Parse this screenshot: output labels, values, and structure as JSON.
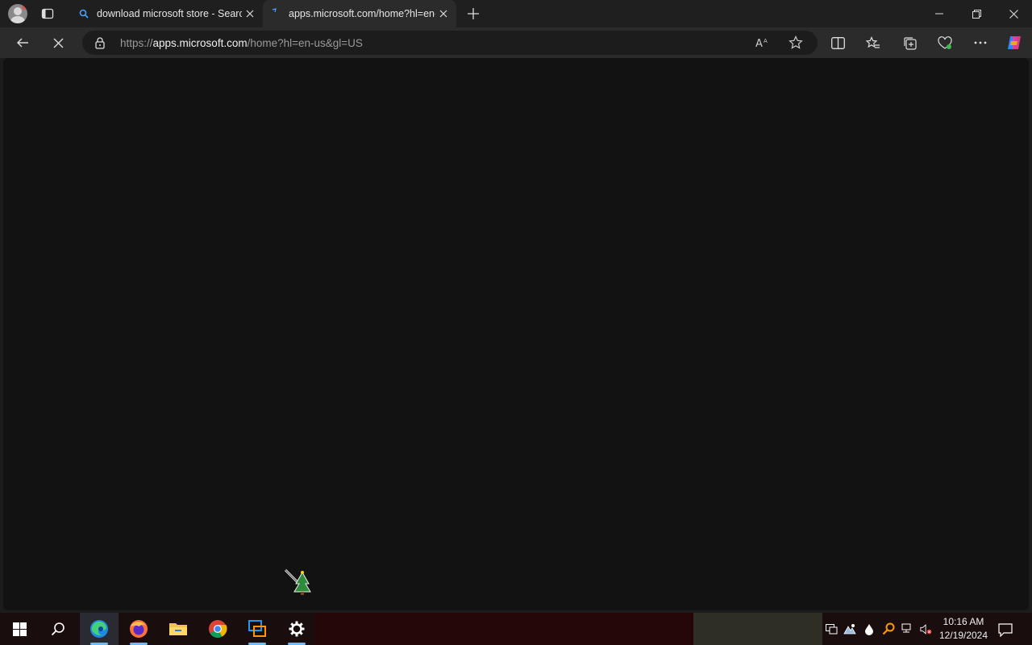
{
  "browser": {
    "tabs": [
      {
        "title": "download microsoft store - Search",
        "favicon": "search-icon"
      },
      {
        "title": "apps.microsoft.com/home?hl=en-us&gl=US",
        "favicon": "loading-icon"
      }
    ],
    "address_bar": {
      "scheme": "https://",
      "host": "apps.microsoft.com",
      "path": "/home?hl=en-us&gl=US"
    }
  },
  "taskbar": {
    "apps": [
      "start-icon",
      "search-icon",
      "edge-icon",
      "firefox-icon",
      "file-explorer-icon",
      "chrome-icon",
      "remote-desktop-icon",
      "settings-icon"
    ],
    "clock": {
      "time": "10:16 AM",
      "date": "12/19/2024"
    }
  },
  "colors": {
    "accent": "#76b9ed",
    "content_bg": "#121212",
    "chrome_bg": "#2b2b2b"
  }
}
